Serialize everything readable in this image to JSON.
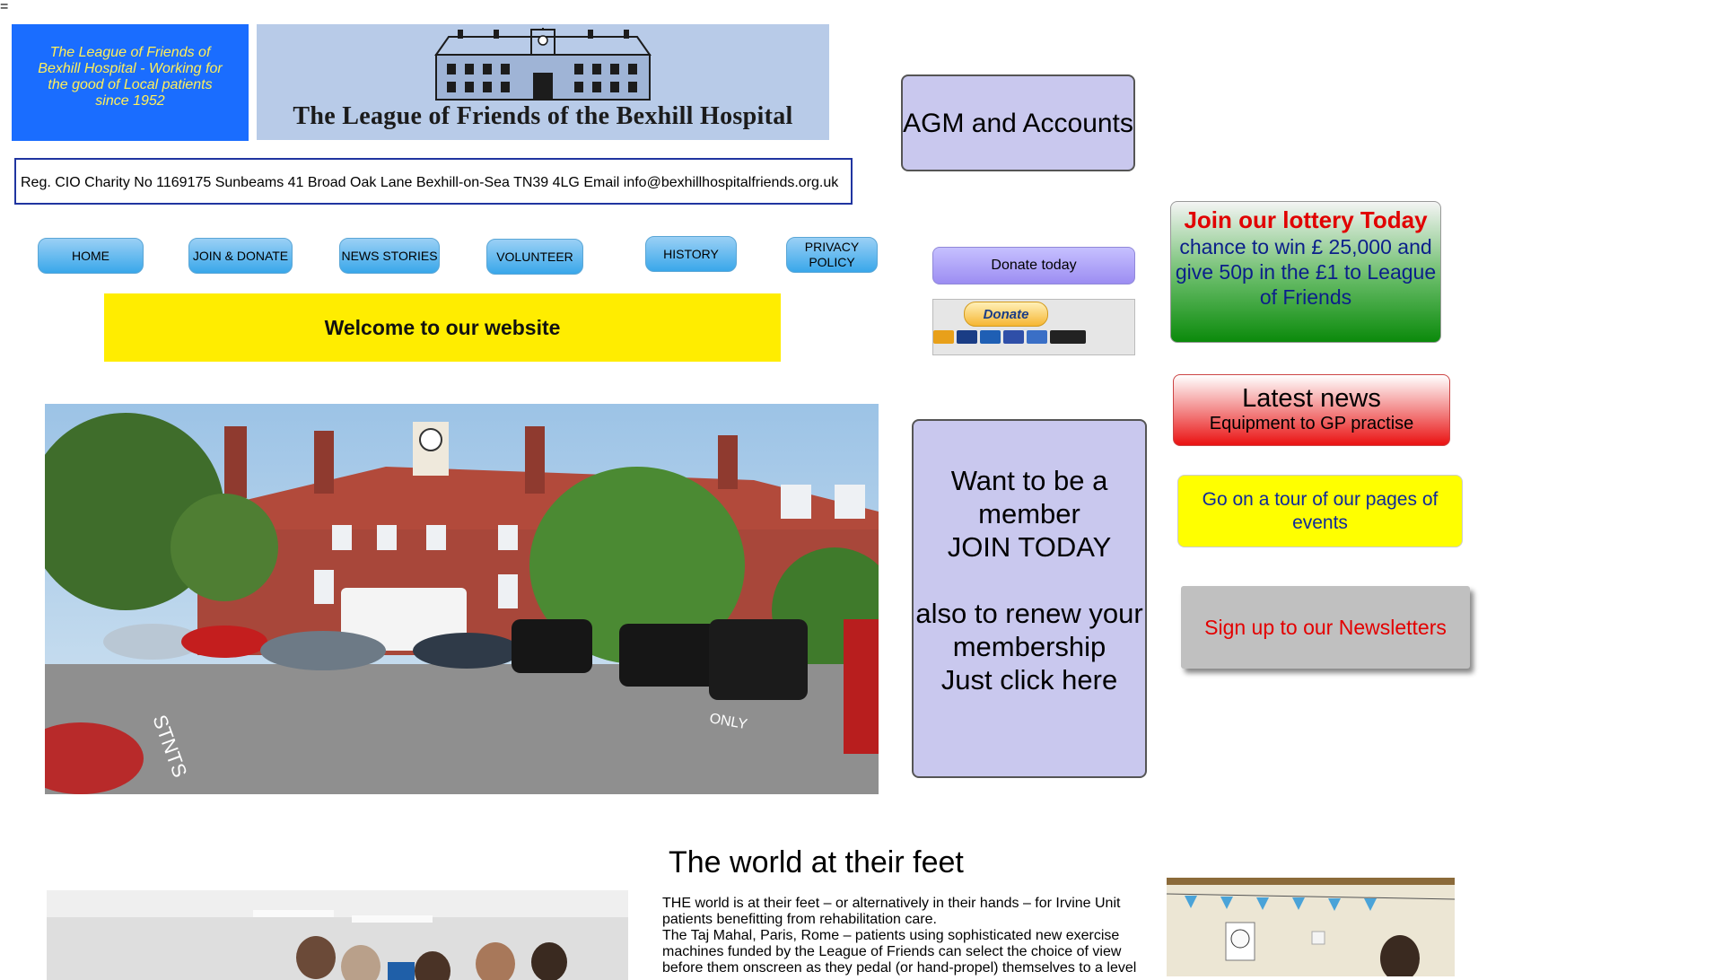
{
  "stray_char": "=",
  "header": {
    "tagline": "The League of Friends of Bexhill Hospital - Working for the good of Local patients since 1952",
    "banner_title": "The League of Friends of the Bexhill Hospital",
    "contact": "Reg. CIO Charity No 1169175 Sunbeams 41 Broad Oak Lane Bexhill-on-Sea TN39 4LG Email info@bexhillhospitalfriends.org.uk"
  },
  "nav": {
    "home": "HOME",
    "join_donate": "JOIN & DONATE",
    "news_stories": "NEWS STORIES",
    "volunteer": "VOLUNTEER",
    "history": "HISTORY",
    "privacy_policy": "PRIVACY POLICY"
  },
  "welcome": "Welcome to our website",
  "agm_button": "AGM and Accounts",
  "donate_today": "Donate today",
  "paypal_button": "Donate",
  "membership": {
    "line1": "Want to be a member",
    "line2": "JOIN TODAY",
    "line3": "also to renew your membership",
    "line4": "Just click here"
  },
  "lottery": {
    "heading": "Join our lottery Today",
    "body": "chance to win £ 25,000 and give 50p in the £1 to League of Friends"
  },
  "news_box": {
    "heading": "Latest news",
    "sub": "Equipment to GP practise"
  },
  "tour": "Go on a tour of our pages of events",
  "signup": "Sign up to our Newsletters",
  "article": {
    "title": "The world at their feet",
    "p1": "THE world is at their feet – or alternatively in their hands – for Irvine Unit patients benefitting from rehabilitation care.",
    "p2": "The Taj Mahal, Paris, Rome – patients using sophisticated new exercise machines funded by the League of Friends can select the choice of view before them onscreen as they pedal (or hand-propel) themselves to a level"
  },
  "colors": {
    "tagline_bg": "#1a6dff",
    "tagline_text": "#ffef5a",
    "welcome_bg": "#ffed00",
    "panel_lilac": "#c9c8ee",
    "lottery_red": "#e10000",
    "tour_yellow": "#ffff00",
    "signup_red": "#e30000"
  }
}
